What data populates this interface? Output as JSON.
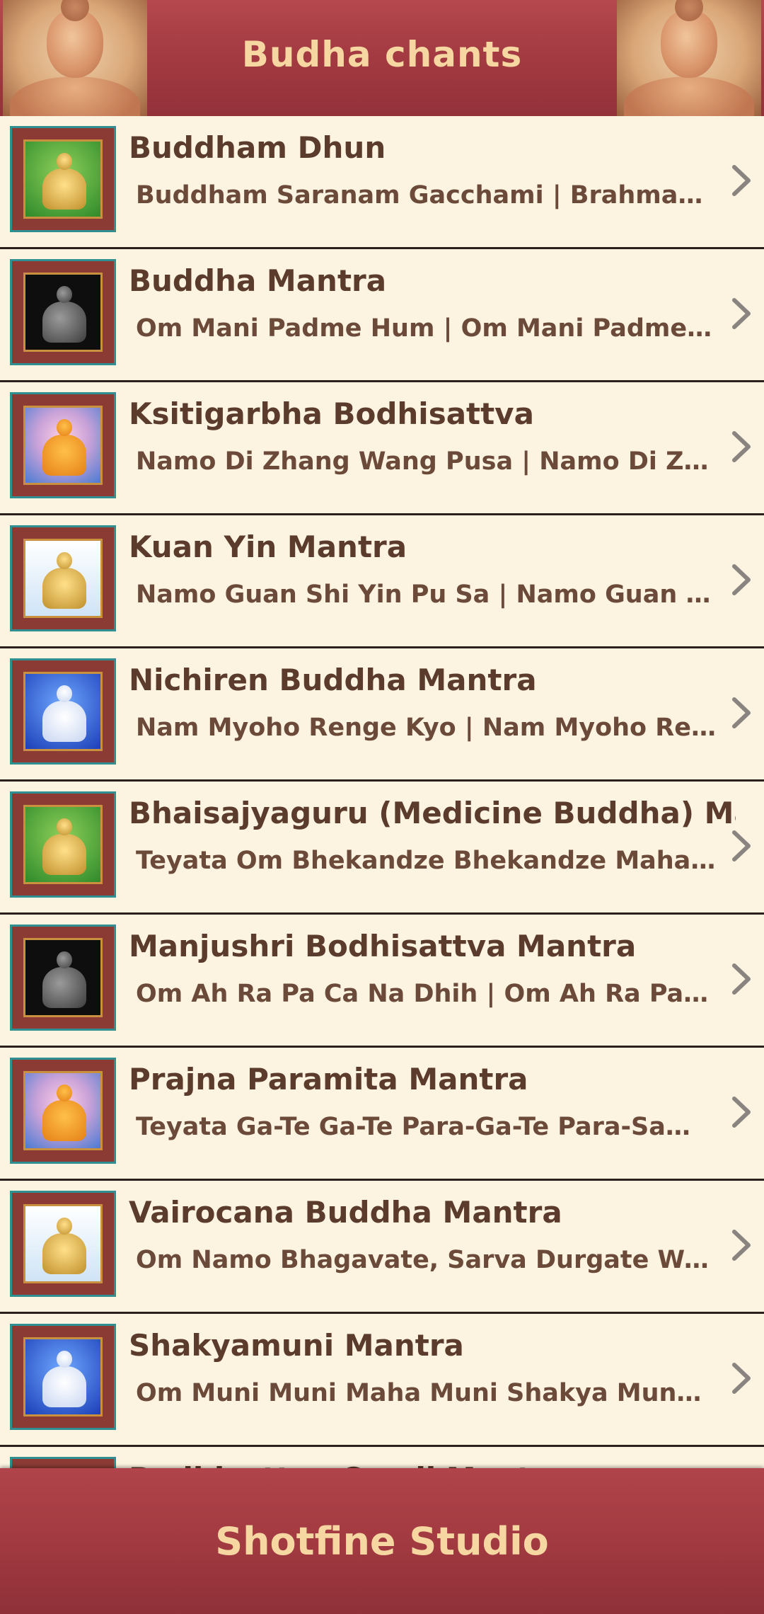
{
  "header": {
    "title": "Budha chants"
  },
  "items": [
    {
      "title": "Buddham Dhun",
      "subtitle": "Buddham Saranam Gacchami | Brahmam Saranam Gacchami",
      "image": "buddha-gold-green"
    },
    {
      "title": "Buddha Mantra",
      "subtitle": "Om Mani Padme Hum | Om Mani Padme Hum",
      "image": "buddha-statue-black"
    },
    {
      "title": "Ksitigarbha Bodhisattva",
      "subtitle": "Namo Di Zhang Wang Pusa | Namo Di Zhang Wang Pusa",
      "image": "buddha-saffron"
    },
    {
      "title": "Kuan Yin Mantra",
      "subtitle": "Namo Guan Shi Yin Pu Sa | Namo Guan Shi Yin Pu Sa",
      "image": "buddha-gold-sky"
    },
    {
      "title": "Nichiren Buddha Mantra",
      "subtitle": "Nam Myoho Renge Kyo | Nam Myoho Renge Kyo",
      "image": "buddha-white-blue"
    },
    {
      "title": "Bhaisajyaguru (Medicine Buddha) Mantra",
      "subtitle": "Teyata Om Bhekandze Bhekandze Maha Bhekandze",
      "image": "buddha-gold-green"
    },
    {
      "title": "Manjushri Bodhisattva Mantra",
      "subtitle": "Om Ah Ra Pa Ca Na Dhih | Om Ah Ra Pa Ca Na Dhih",
      "image": "buddha-statue-black"
    },
    {
      "title": "Prajna Paramita Mantra",
      "subtitle": "Teyata Ga-Te Ga-Te Para-Ga-Te Para-Sam-Ga-Te",
      "image": "buddha-saffron"
    },
    {
      "title": "Vairocana Buddha Mantra",
      "subtitle": "Om Namo Bhagavate, Sarva Durgate Wana Sodhana",
      "image": "buddha-gold-sky"
    },
    {
      "title": "Shakyamuni Mantra",
      "subtitle": "Om Muni Muni Maha Muni Shakya Munaye Svaha",
      "image": "buddha-white-blue"
    },
    {
      "title": "Bodhisattva Cundi Mantra",
      "subtitle": "",
      "image": "buddha-gold-green"
    }
  ],
  "footer": {
    "text": "Shotfine Studio"
  },
  "icons": {
    "row_action": "chevron-right-icon"
  },
  "colors": {
    "header_bg": "#a33a41",
    "header_text": "#f6d7a1",
    "list_bg": "#fdf3e1",
    "title_text": "#5b3b2c",
    "thumb_border": "#2f8f91"
  }
}
